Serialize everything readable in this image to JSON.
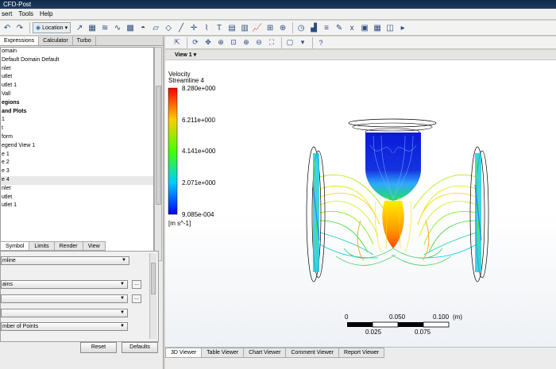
{
  "app": {
    "title": "CFD-Post"
  },
  "menu": [
    "sert",
    "Tools",
    "Help"
  ],
  "toolbar": {
    "location_label": "Location",
    "icons": [
      "undo-icon",
      "redo-icon",
      "location-icon",
      "vector-icon",
      "contour-icon",
      "streamline-icon",
      "particle-icon",
      "volume-render-icon",
      "isosurface-icon",
      "surface-icon",
      "plane-icon",
      "line-icon",
      "point-icon",
      "polyline-icon",
      "text-icon",
      "legend-icon",
      "clock-icon",
      "chart-icon",
      "table-icon",
      "probe-icon",
      "report-icon",
      "expression-icon",
      "variables-icon",
      "macros-icon",
      "turbo-icon",
      "command-icon"
    ]
  },
  "left_tabs": [
    "Expressions",
    "Calculator",
    "Turbo"
  ],
  "tree": [
    {
      "label": "omain",
      "bold": false
    },
    {
      "label": "Default Domain Default",
      "bold": false
    },
    {
      "label": "nlet",
      "bold": false
    },
    {
      "label": "utlet",
      "bold": false
    },
    {
      "label": "utlet 1",
      "bold": false
    },
    {
      "label": "Vall",
      "bold": false
    },
    {
      "label": "egions",
      "bold": true
    },
    {
      "label": "and Plots",
      "bold": true
    },
    {
      "label": "1",
      "bold": false
    },
    {
      "label": "t",
      "bold": false
    },
    {
      "label": "form",
      "bold": false
    },
    {
      "label": "egend View 1",
      "bold": false
    },
    {
      "label": "e 1",
      "bold": false
    },
    {
      "label": "e 2",
      "bold": false
    },
    {
      "label": "e 3",
      "bold": false
    },
    {
      "label": "e 4",
      "bold": false
    },
    {
      "label": "nlet",
      "bold": false
    },
    {
      "label": "utlet",
      "bold": false
    },
    {
      "label": "utlet 1",
      "bold": false
    }
  ],
  "tree_selected": 15,
  "detail_tabs": [
    "Symbol",
    "Limits",
    "Render",
    "View"
  ],
  "details": {
    "type_value": "mline",
    "domains_value": "ains",
    "start_from_value": "",
    "locations_value": "",
    "sampling_value": "mber of Points",
    "reset_label": "Reset",
    "defaults_label": "Defaults"
  },
  "viewer": {
    "view_name": "View 1",
    "legend": {
      "variable": "Velocity",
      "object": "Streamline 4",
      "max": "8.280e+000",
      "v2": "6.211e+000",
      "v3": "4.141e+000",
      "v4": "2.071e+000",
      "min": "9.085e-004",
      "unit": "[m s^-1]"
    },
    "ruler": {
      "top_labels": [
        "0",
        "0.050",
        "0.100",
        "(m)"
      ],
      "bottom_labels": [
        "0.025",
        "0.075"
      ]
    }
  },
  "bottom_tabs": [
    "3D Viewer",
    "Table Viewer",
    "Chart Viewer",
    "Comment Viewer",
    "Report Viewer"
  ],
  "colors": {
    "accent_blue": "#2b4c7e",
    "legend_top": "#ff0000",
    "legend_bottom": "#0000ff"
  }
}
